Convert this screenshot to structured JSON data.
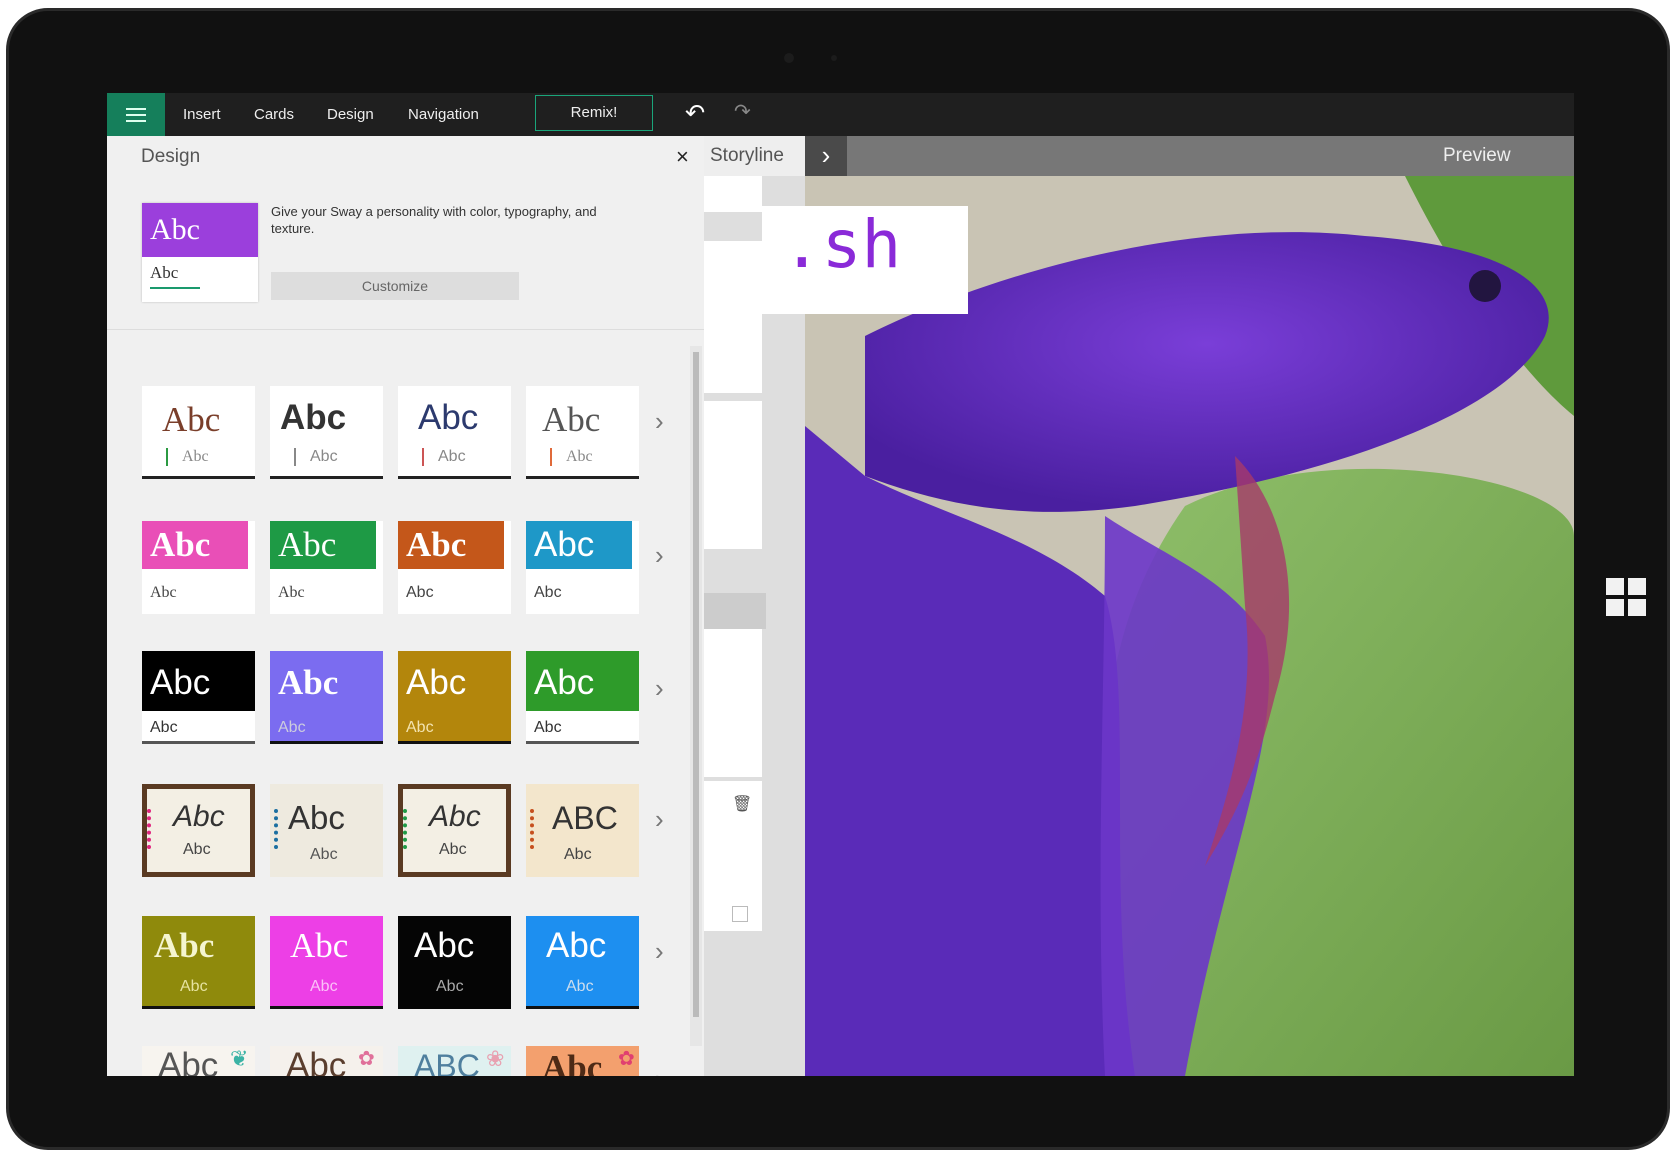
{
  "topbar": {
    "menu_items": [
      "Insert",
      "Cards",
      "Design",
      "Navigation"
    ],
    "remix": "Remix!",
    "undo_icon": "undo-icon",
    "redo_icon": "redo-icon"
  },
  "design_panel": {
    "title": "Design",
    "close": "×",
    "description": "Give your Sway a personality with color, typography, and texture.",
    "customize": "Customize",
    "preview_big": "Abc",
    "preview_small": "Abc"
  },
  "styles": {
    "row1": [
      "Abc",
      "Abc",
      "Abc",
      "Abc"
    ],
    "row1_sub": [
      "Abc",
      "Abc",
      "Abc",
      "Abc"
    ],
    "row2": [
      "Abc",
      "Abc",
      "Abc",
      "Abc"
    ],
    "row2_sub": [
      "Abc",
      "Abc",
      "Abc",
      "Abc"
    ],
    "row3": [
      "Abc",
      "Abc",
      "Abc",
      "Abc"
    ],
    "row3_sub": [
      "Abc",
      "Abc",
      "Abc",
      "Abc"
    ],
    "row4": [
      "Abc",
      "Abc",
      "Abc",
      "ABC"
    ],
    "row4_sub": [
      "Abc",
      "Abc",
      "Abc",
      "Abc"
    ],
    "row5": [
      "Abc",
      "Abc",
      "Abc",
      "Abc"
    ],
    "row5_sub": [
      "Abc",
      "Abc",
      "Abc",
      "Abc"
    ],
    "row6": [
      "Abc",
      "Abc",
      "ABC",
      "Abc"
    ]
  },
  "storyline": {
    "tab": "Storyline"
  },
  "preview": {
    "label": "Preview",
    "title_fragment": ".sh",
    "arrow": "›"
  },
  "colors": {
    "accent": "#157f5b",
    "purple": "#9b3fdc"
  }
}
